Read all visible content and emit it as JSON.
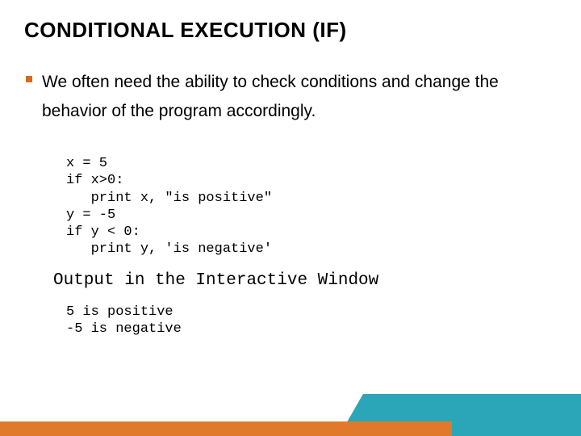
{
  "title": "CONDITIONAL EXECUTION (IF)",
  "bullet": "We often need the ability to check conditions and change the behavior of the program accordingly.",
  "code": "x = 5\nif x>0:\n   print x, \"is positive\"\ny = -5\nif y < 0:\n   print y, 'is negative'",
  "output_label": "Output in the Interactive Window",
  "output": "5 is positive\n-5 is negative",
  "colors": {
    "accent_bullet": "#d86a1e",
    "footer_orange": "#e07a2a",
    "footer_teal": "#2aa6b8"
  }
}
